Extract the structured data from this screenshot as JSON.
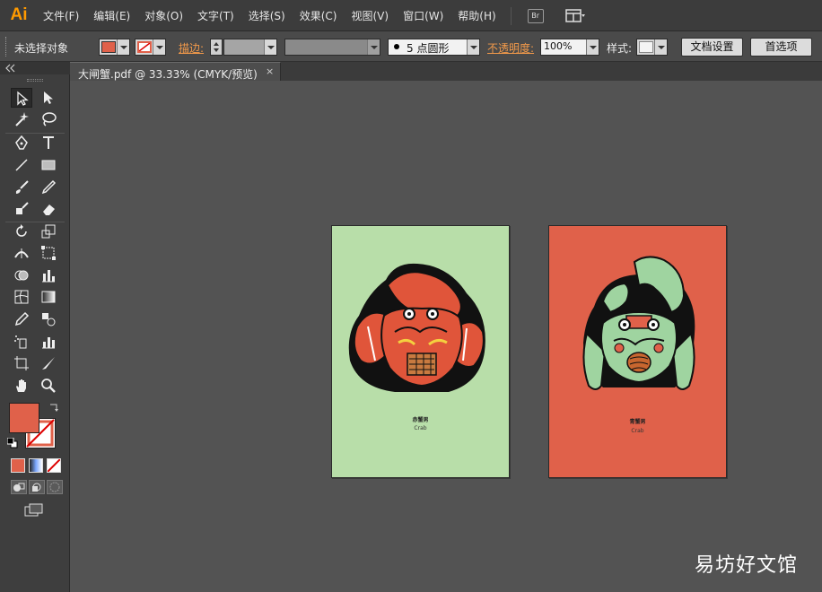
{
  "app": {
    "logo": "Ai"
  },
  "menu": {
    "items": [
      "文件(F)",
      "编辑(E)",
      "对象(O)",
      "文字(T)",
      "选择(S)",
      "效果(C)",
      "视图(V)",
      "窗口(W)",
      "帮助(H)"
    ],
    "bridge_label": "Br"
  },
  "control_bar": {
    "selection_status": "未选择对象",
    "fill_color": "#e0614a",
    "stroke_label": "描边:",
    "brush_value": "5 点圆形",
    "opacity_label": "不透明度:",
    "opacity_value": "100%",
    "style_label": "样式:",
    "doc_setup_button": "文档设置",
    "preferences_button": "首选项"
  },
  "document": {
    "tab_label": "大闸蟹.pdf @ 33.33% (CMYK/预览)",
    "close_glyph": "×"
  },
  "artboards": [
    {
      "bg": "#b8dea9",
      "crab_color": "#e0553a",
      "title": "赤蟹男",
      "subtitle": "Crab"
    },
    {
      "bg": "#e0614a",
      "crab_color": "#9fd4a0",
      "title": "青蟹男",
      "subtitle": "Crab"
    }
  ],
  "tools_panel": {
    "fill_color": "#e0614a"
  },
  "watermark": "易坊好文馆"
}
